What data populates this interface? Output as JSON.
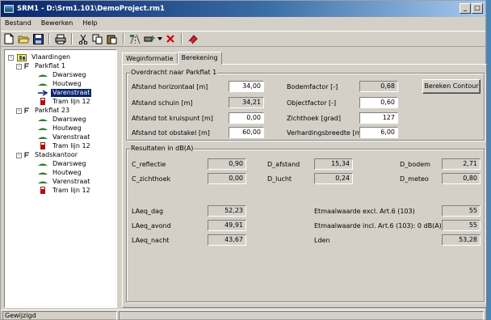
{
  "window": {
    "title": "SRM1 - D:\\Srm1.101\\DemoProject.rm1",
    "minimize_label": "_",
    "close_label": "□"
  },
  "menu": {
    "items": [
      "Bestand",
      "Bewerken",
      "Help"
    ]
  },
  "toolbar": {
    "icons": [
      "new-icon",
      "open-icon",
      "save-icon",
      "print-icon",
      "cut-icon",
      "copy-icon",
      "paste-icon",
      "add-road-icon",
      "add-item-icon",
      "delete-icon",
      "calculate-icon"
    ]
  },
  "tree": {
    "root": "Vlaardingen",
    "nodes": [
      {
        "label": "Parkflat 1",
        "children": [
          "Dwarsweg",
          "Houtweg",
          "Varenstraat",
          "Tram lijn 12"
        ],
        "selected_child": 2
      },
      {
        "label": "Parkflat 23",
        "children": [
          "Dwarsweg",
          "Houtweg",
          "Varenstraat",
          "Tram lijn 12"
        ]
      },
      {
        "label": "Stadskantoor",
        "children": [
          "Dwarsweg",
          "Houtweg",
          "Varenstraat",
          "Tram lijn 12"
        ]
      }
    ]
  },
  "tabs": {
    "weginformatie": "Weginformatie",
    "berekening": "Berekening"
  },
  "overdracht": {
    "title": "Overdracht naar Parkflat 1",
    "afstand_horizontaal": {
      "label": "Afstand horizontaal [m]",
      "value": "34,00"
    },
    "afstand_schuin": {
      "label": "Afstand schuin [m]",
      "value": "34,21"
    },
    "afstand_kruispunt": {
      "label": "Afstand tot kruispunt [m]",
      "value": "0,00"
    },
    "afstand_obstakel": {
      "label": "Afstand tot obstakel [m]",
      "value": "60,00"
    },
    "bodemfactor": {
      "label": "Bodemfactor [-]",
      "value": "0,68"
    },
    "objectfactor": {
      "label": "Objectfactor [-]",
      "value": "0,60"
    },
    "zichthoek": {
      "label": "Zichthoek [grad]",
      "value": "127"
    },
    "verhardingsbreedte": {
      "label": "Verhardingsbreedte [m]",
      "value": "6,00"
    },
    "bereken_button": "Bereken Contour"
  },
  "resultaten": {
    "title": "Resultaten in dB(A)",
    "c_reflectie": {
      "label": "C_reflectie",
      "value": "0,90"
    },
    "c_zichthoek": {
      "label": "C_zichthoek",
      "value": "0,00"
    },
    "d_afstand": {
      "label": "D_afstand",
      "value": "15,34"
    },
    "d_lucht": {
      "label": "D_lucht",
      "value": "0,24"
    },
    "d_bodem": {
      "label": "D_bodem",
      "value": "2,71"
    },
    "d_meteo": {
      "label": "D_meteo",
      "value": "0,80"
    },
    "laeq_dag": {
      "label": "LAeq_dag",
      "value": "52,23"
    },
    "laeq_avond": {
      "label": "LAeq_avond",
      "value": "49,91"
    },
    "laeq_nacht": {
      "label": "LAeq_nacht",
      "value": "43,67"
    },
    "etmaal_excl": {
      "label": "Etmaalwaarde excl. Art.6 (103)",
      "value": "55"
    },
    "etmaal_incl": {
      "label": "Etmaalwaarde incl. Art.6 (103): 0 dB(A)",
      "value": "55"
    },
    "lden": {
      "label": "Lden",
      "value": "53,28"
    }
  },
  "status": {
    "text": "Gewijzigd"
  }
}
